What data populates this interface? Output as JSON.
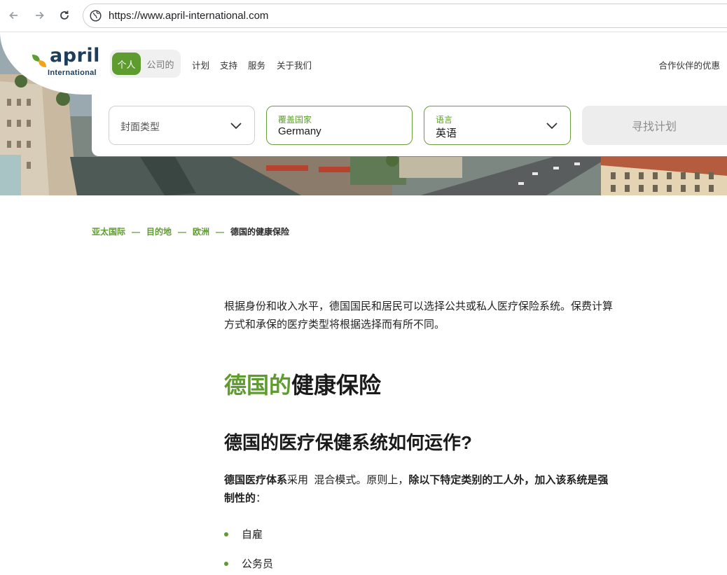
{
  "browser": {
    "url": "https://www.april-international.com"
  },
  "header": {
    "logo_word": "april",
    "logo_sub": "International",
    "segment_personal": "个人",
    "segment_company": "公司的",
    "nav": [
      "计划",
      "支持",
      "服务",
      "关于我们"
    ],
    "partner_link": "合作伙伴的优惠"
  },
  "search": {
    "cover_type_placeholder": "封面类型",
    "country_label": "覆盖国家",
    "country_value": "Germany",
    "language_label": "语言",
    "language_value": "英语",
    "find_button": "寻找计划"
  },
  "breadcrumb": {
    "items": [
      "亚太国际",
      "目的地",
      "欧洲"
    ],
    "current": "德国的健康保险",
    "separator": "—"
  },
  "content": {
    "intro": "根据身份和收入水平，德国国民和居民可以选择公共或私人医疗保险系统。保费计算方式和承保的医疗类型将根据选择而有所不同。",
    "title_accent": "德国的",
    "title_rest": "健康保险",
    "subtitle": "德国的医疗保健系统如何运作?",
    "para_bold1": "德国医疗体系",
    "para_text1": "采用  混合模式。原则上，",
    "para_bold2": "除以下特定类别的工人外，加入该系统是强制性的",
    "para_text2": "：",
    "bullets": [
      "自雇",
      "公务员"
    ]
  },
  "colors": {
    "brand_green": "#5e9c2f",
    "brand_navy": "#1d3d5c"
  }
}
